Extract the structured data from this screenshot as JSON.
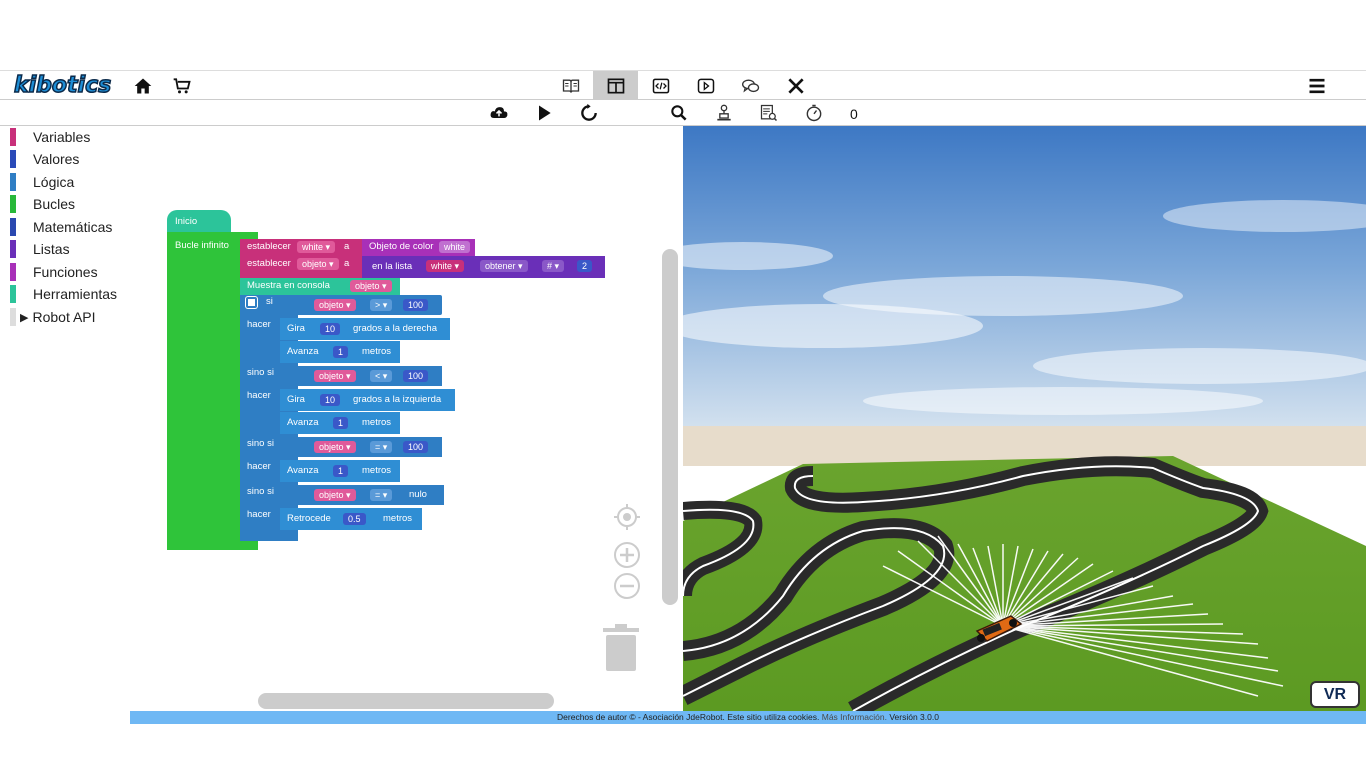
{
  "brand": {
    "logo_text": "kibotics"
  },
  "categories": [
    {
      "label": "Variables",
      "color": "#c8307a"
    },
    {
      "label": "Valores",
      "color": "#2a4ab8"
    },
    {
      "label": "Lógica",
      "color": "#2f7ec4"
    },
    {
      "label": "Bucles",
      "color": "#28b83a"
    },
    {
      "label": "Matemáticas",
      "color": "#2a48b0"
    },
    {
      "label": "Listas",
      "color": "#6a2fb8"
    },
    {
      "label": "Funciones",
      "color": "#a830b8"
    },
    {
      "label": "Herramientas",
      "color": "#2cc49a"
    },
    {
      "label": "Robot API",
      "color": "#000000",
      "expandable": true
    }
  ],
  "toolbar": {
    "counter": "0"
  },
  "blocks": {
    "start": "Inicio",
    "loop": "Bucle infinito",
    "set1": {
      "prefix": "establecer",
      "var": "white",
      "to": "a",
      "value_label": "Objeto de color",
      "value_arg": "white"
    },
    "set2": {
      "prefix": "establecer",
      "var": "objeto",
      "to": "a",
      "list_label": "en la lista",
      "list_var": "white",
      "op": "obtener",
      "hash": "#",
      "index": "2"
    },
    "print": {
      "label": "Muestra en consola",
      "var": "objeto"
    },
    "if1": {
      "kw": "si",
      "var": "objeto",
      "op": ">",
      "value": "100"
    },
    "do1": "hacer",
    "turn_right": {
      "label": "Gira",
      "value": "10",
      "suffix": "grados a la derecha"
    },
    "fwd1": {
      "label": "Avanza",
      "value": "1",
      "suffix": "metros"
    },
    "elif2": {
      "kw": "sino si",
      "var": "objeto",
      "op": "<",
      "value": "100"
    },
    "do2": "hacer",
    "turn_left": {
      "label": "Gira",
      "value": "10",
      "suffix": "grados a la izquierda"
    },
    "fwd2": {
      "label": "Avanza",
      "value": "1",
      "suffix": "metros"
    },
    "elif3": {
      "kw": "sino si",
      "var": "objeto",
      "op": "=",
      "value": "100"
    },
    "do3": "hacer",
    "fwd3": {
      "label": "Avanza",
      "value": "1",
      "suffix": "metros"
    },
    "elif4": {
      "kw": "sino si",
      "var": "objeto",
      "op": "=",
      "value": "nulo"
    },
    "do4": "hacer",
    "back": {
      "label": "Retrocede",
      "value": "0.5",
      "suffix": "metros"
    }
  },
  "scene": {
    "vr_label": "VR"
  },
  "footer": {
    "text": "Derechos de autor © - Asociación JdeRobot. Este sitio utiliza cookies.",
    "more": "Más Información.",
    "version": "Versión 3.0.0"
  }
}
